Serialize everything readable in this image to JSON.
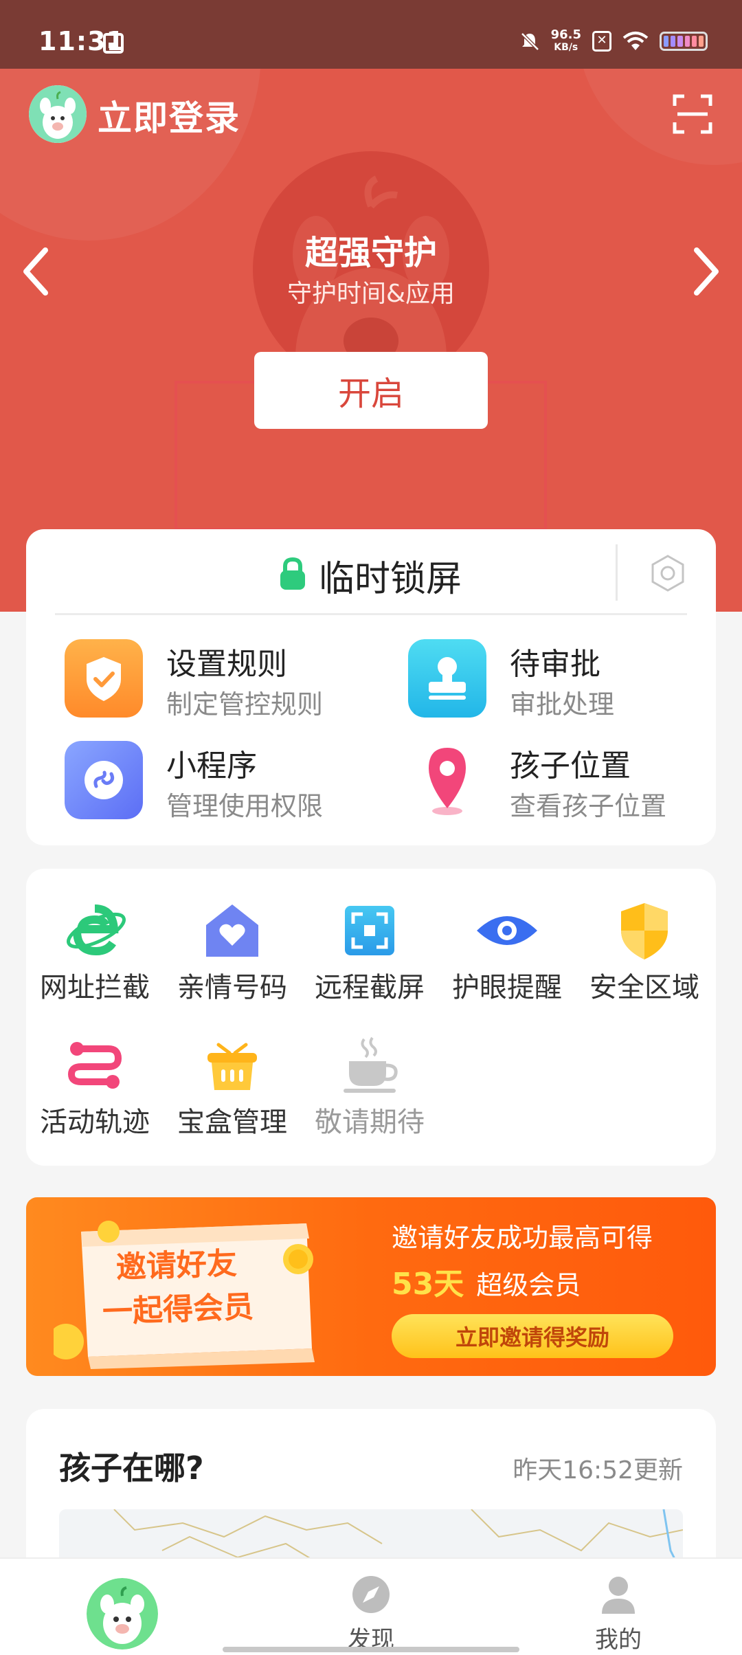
{
  "status_bar": {
    "time": "11:31",
    "net_speed_value": "96.5",
    "net_speed_unit": "KB/s",
    "icons": [
      "sim-icon",
      "mute-icon",
      "x-icon",
      "wifi-icon",
      "battery-icon"
    ]
  },
  "header": {
    "login_label": "立即登录",
    "carousel": {
      "title": "超强守护",
      "subtitle": "守护时间&应用"
    },
    "open_button": "开启",
    "colors": {
      "header_bg": "#e1584a",
      "accent": "#d9473c"
    }
  },
  "lock_card": {
    "lock_label": "临时锁屏",
    "features": [
      {
        "name": "设置规则",
        "desc": "制定管控规则",
        "icon": "shield-check-icon"
      },
      {
        "name": "待审批",
        "desc": "审批处理",
        "icon": "stamp-icon"
      },
      {
        "name": "小程序",
        "desc": "管理使用权限",
        "icon": "mini-program-icon"
      },
      {
        "name": "孩子位置",
        "desc": "查看孩子位置",
        "icon": "location-pin-icon"
      }
    ]
  },
  "tools": [
    {
      "label": "网址拦截",
      "icon": "browser-e-icon"
    },
    {
      "label": "亲情号码",
      "icon": "home-heart-icon"
    },
    {
      "label": "远程截屏",
      "icon": "screenshot-icon"
    },
    {
      "label": "护眼提醒",
      "icon": "eye-icon"
    },
    {
      "label": "安全区域",
      "icon": "shield-icon"
    },
    {
      "label": "活动轨迹",
      "icon": "track-icon"
    },
    {
      "label": "宝盒管理",
      "icon": "basket-icon"
    },
    {
      "label": "敬请期待",
      "icon": "coffee-cup-icon"
    }
  ],
  "banner": {
    "scroll_line1": "邀请好友",
    "scroll_line2": "一起得会员",
    "headline": "邀请好友成功最高可得",
    "days": "53天",
    "reward": "超级会员",
    "button": "立即邀请得奖励"
  },
  "location_card": {
    "title": "孩子在哪?",
    "updated": "昨天16:52更新"
  },
  "bottom_nav": {
    "discover": "发现",
    "mine": "我的"
  }
}
